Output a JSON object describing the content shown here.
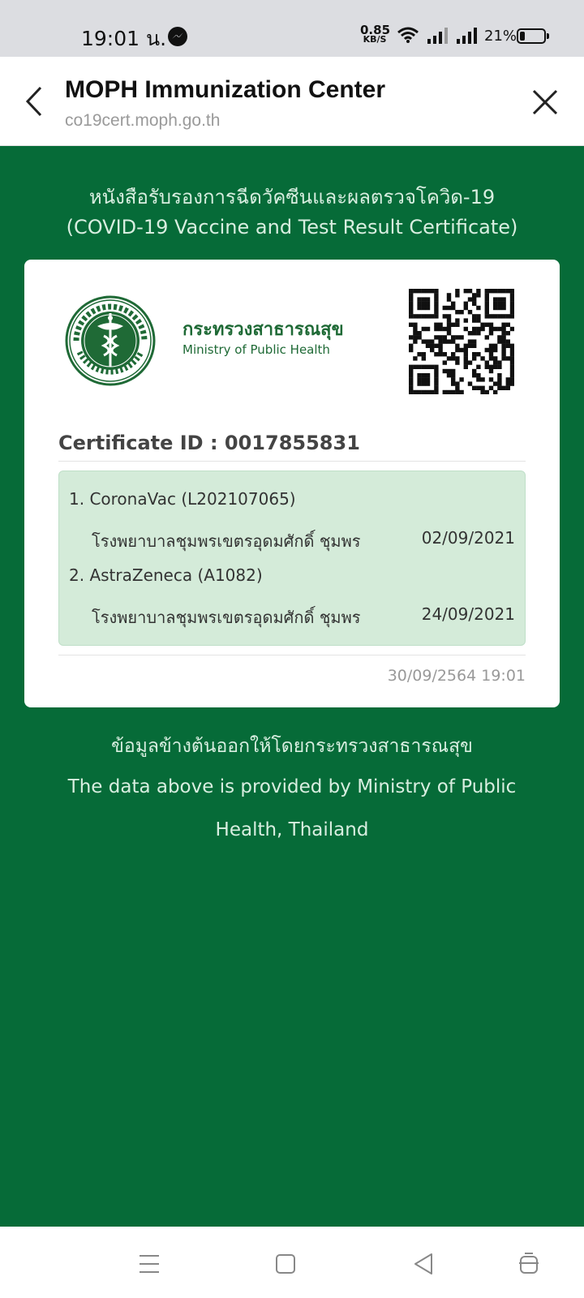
{
  "status_bar": {
    "time": "19:01 น.",
    "net_speed_value": "0.85",
    "net_speed_unit": "KB/S",
    "battery_pct": "21%",
    "battery_level": 0.21
  },
  "browser": {
    "title": "MOPH Immunization Center",
    "url": "co19cert.moph.go.th"
  },
  "certificate": {
    "heading_th": "หนังสือรับรองการฉีดวัคซีนและผลตรวจโควิด-19",
    "heading_en": "(COVID-19 Vaccine and Test Result Certificate)",
    "ministry_th": "กระทรวงสาธารณสุข",
    "ministry_en": "Ministry of Public Health",
    "cert_id": "Certificate ID : 0017855831",
    "vaccines": [
      {
        "name": "1. CoronaVac (L202107065)",
        "place": "โรงพยาบาลชุมพรเขตรอุดมศักดิ์ ชุมพร",
        "date": "02/09/2021"
      },
      {
        "name": "2. AstraZeneca (A1082)",
        "place": "โรงพยาบาลชุมพรเขตรอุดมศักดิ์ ชุมพร",
        "date": "24/09/2021"
      }
    ],
    "timestamp": "30/09/2564 19:01"
  },
  "footer": {
    "th": "ข้อมูลข้างต้นออกให้โดยกระทรวงสาธารณสุข",
    "en": "The data above is provided by Ministry of Public Health, Thailand"
  },
  "colors": {
    "page_background": "#066b38",
    "ministry_green": "#1f6a36",
    "vaccine_box": "#d4ebd9"
  }
}
